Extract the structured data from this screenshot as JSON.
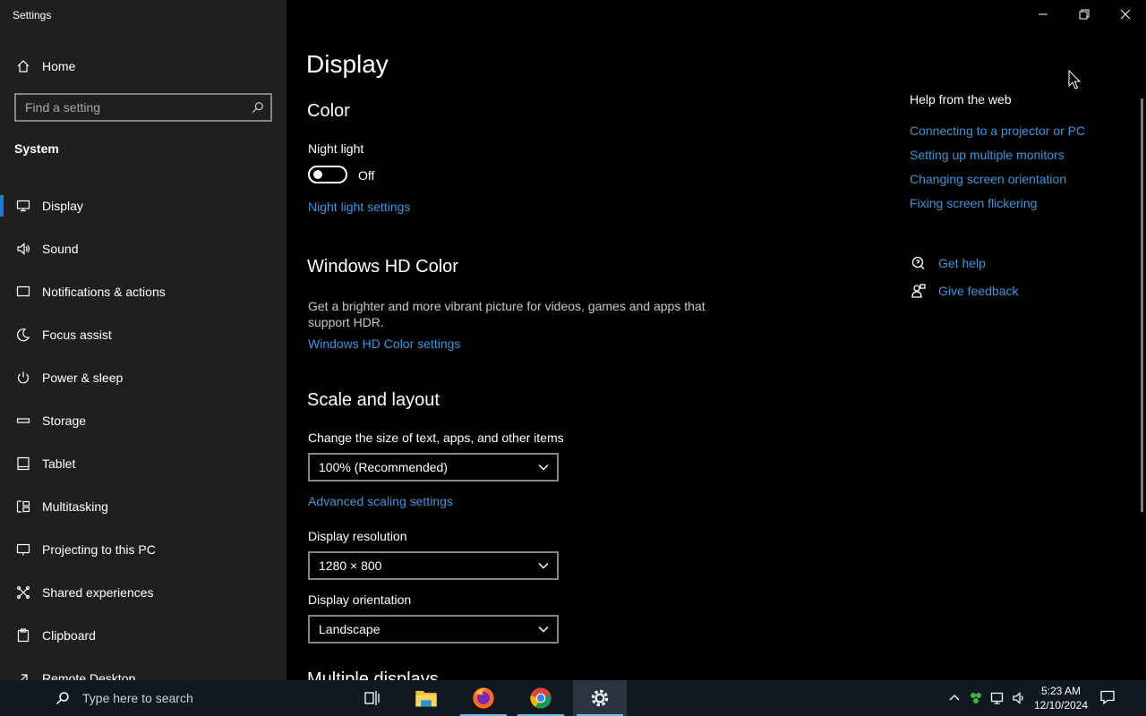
{
  "window": {
    "title": "Settings"
  },
  "sidebar": {
    "home_label": "Home",
    "search_placeholder": "Find a setting",
    "section_label": "System",
    "items": [
      {
        "label": "Display",
        "icon": "monitor-icon",
        "selected": true
      },
      {
        "label": "Sound",
        "icon": "speaker-icon"
      },
      {
        "label": "Notifications & actions",
        "icon": "notification-icon"
      },
      {
        "label": "Focus assist",
        "icon": "moon-icon"
      },
      {
        "label": "Power & sleep",
        "icon": "power-icon"
      },
      {
        "label": "Storage",
        "icon": "storage-icon"
      },
      {
        "label": "Tablet",
        "icon": "tablet-icon"
      },
      {
        "label": "Multitasking",
        "icon": "multitasking-icon"
      },
      {
        "label": "Projecting to this PC",
        "icon": "projecting-icon"
      },
      {
        "label": "Shared experiences",
        "icon": "shared-experiences-icon"
      },
      {
        "label": "Clipboard",
        "icon": "clipboard-icon"
      },
      {
        "label": "Remote Desktop",
        "icon": "remote-desktop-icon"
      }
    ]
  },
  "main": {
    "title": "Display",
    "color": {
      "heading": "Color",
      "night_light_label": "Night light",
      "night_light_state": "Off",
      "night_light_settings_link": "Night light settings"
    },
    "hd_color": {
      "heading": "Windows HD Color",
      "description": "Get a brighter and more vibrant picture for videos, games and apps that support HDR.",
      "settings_link": "Windows HD Color settings"
    },
    "scale": {
      "heading": "Scale and layout",
      "size_label": "Change the size of text, apps, and other items",
      "size_value": "100% (Recommended)",
      "advanced_link": "Advanced scaling settings",
      "resolution_label": "Display resolution",
      "resolution_value": "1280 × 800",
      "orientation_label": "Display orientation",
      "orientation_value": "Landscape",
      "next_heading_partial": "Multiple displays"
    }
  },
  "help": {
    "title": "Help from the web",
    "links": [
      "Connecting to a projector or PC",
      "Setting up multiple monitors",
      "Changing screen orientation",
      "Fixing screen flickering"
    ],
    "get_help": "Get help",
    "give_feedback": "Give feedback"
  },
  "taskbar": {
    "search_placeholder": "Type here to search",
    "apps": [
      "task-view",
      "file-explorer",
      "firefox",
      "chrome",
      "settings"
    ],
    "clock_time": "5:23 AM",
    "clock_date": "12/10/2024"
  },
  "colors": {
    "sidebar_bg": "#1f1f1f",
    "main_bg": "#000000",
    "link": "#3a96dd",
    "accent": "#1a7fd4",
    "taskbar_bg": "#101820"
  }
}
